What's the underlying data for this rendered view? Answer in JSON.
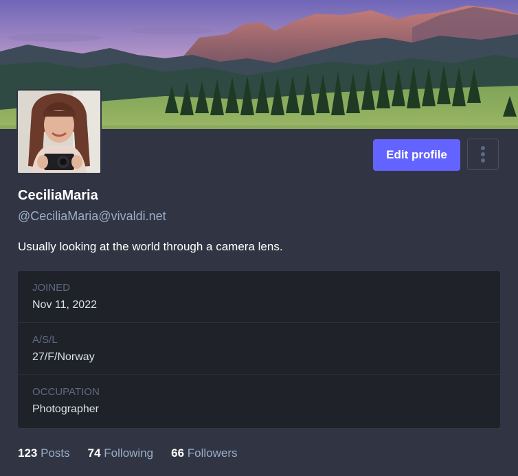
{
  "profile": {
    "display_name": "CeciliaMaria",
    "handle": "@CeciliaMaria@vivaldi.net",
    "bio": "Usually looking at the world through a camera lens.",
    "edit_label": "Edit profile",
    "more_icon": "more-vertical-icon",
    "header_image": "mountain-landscape",
    "avatar_image": "woman-with-camera"
  },
  "fields": [
    {
      "name": "JOINED",
      "value": "Nov 11, 2022"
    },
    {
      "name": "A/S/L",
      "value": "27/F/Norway"
    },
    {
      "name": "OCCUPATION",
      "value": "Photographer"
    }
  ],
  "stats": {
    "posts_count": "123",
    "posts_label": "Posts",
    "following_count": "74",
    "following_label": "Following",
    "followers_count": "66",
    "followers_label": "Followers"
  },
  "colors": {
    "background": "#313543",
    "accent": "#6364ff",
    "fields_bg": "#202229",
    "secondary_text": "#9baec8",
    "field_label": "#606984"
  }
}
